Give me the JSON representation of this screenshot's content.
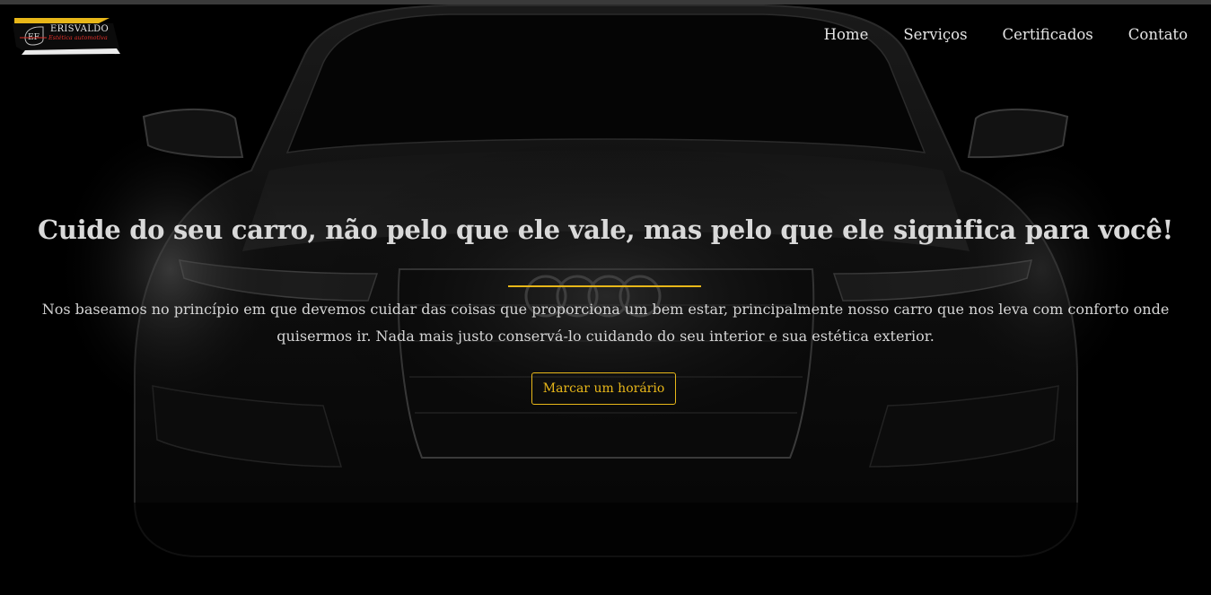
{
  "brand": {
    "name": "ERISVALDO",
    "tagline": "Estética automotiva",
    "monogram": "EF"
  },
  "nav": {
    "items": [
      {
        "label": "Home"
      },
      {
        "label": "Serviços"
      },
      {
        "label": "Certificados"
      },
      {
        "label": "Contato"
      }
    ]
  },
  "hero": {
    "title": "Cuide do seu carro, não pelo que ele vale, mas pelo que ele significa para você!",
    "text": "Nos baseamos no princípio em que devemos cuidar das coisas que proporciona um bem estar, principalmente nosso carro que nos leva com conforto onde quisermos ir. Nada mais justo conservá-lo cuidando do seu interior e sua estética exterior.",
    "cta_label": "Marcar um horário"
  },
  "colors": {
    "accent": "#e8b719",
    "background": "#000000",
    "text": "#d9d9d9",
    "logo_red": "#e0302a"
  },
  "icons": {
    "logo": "car-detailing-logo",
    "background": "dark-car-front-image"
  }
}
